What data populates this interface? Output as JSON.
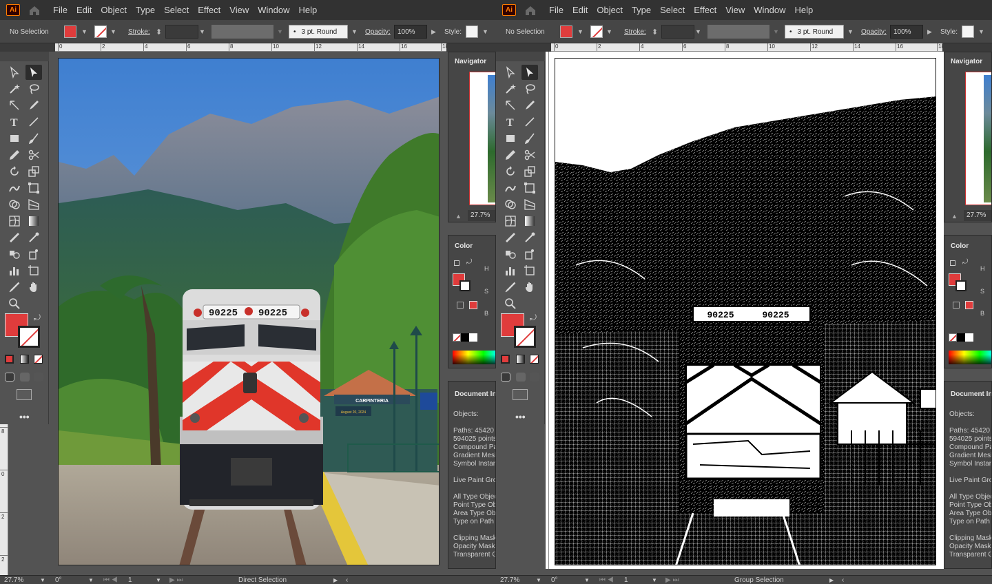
{
  "app": {
    "logo_text": "Ai"
  },
  "menu": [
    "File",
    "Edit",
    "Object",
    "Type",
    "Select",
    "Effect",
    "View",
    "Window",
    "Help"
  ],
  "control_bar": {
    "selection": "No Selection",
    "stroke_label": "Stroke:",
    "brush": "3 pt. Round",
    "opacity_label": "Opacity:",
    "opacity_value": "100%",
    "style_label": "Style:"
  },
  "ruler": {
    "h_ticks": [
      "0",
      "2",
      "4",
      "6",
      "8",
      "10",
      "12",
      "14",
      "16",
      "18"
    ],
    "v_ticks": [
      "8",
      "0",
      "2",
      "2",
      "2"
    ]
  },
  "panels": {
    "navigator": {
      "title": "Navigator",
      "zoom": "27.7%"
    },
    "color": {
      "title": "Color",
      "h": "H",
      "s": "S",
      "b": "B"
    },
    "document_info": {
      "title": "Document Info",
      "objects_label": "Objects:",
      "lines_a": [
        "Paths: 45420",
        "594025 points",
        "Compound Pa",
        "Gradient Mesh",
        "Symbol Instan"
      ],
      "lines_b": [
        "Live Paint Gro"
      ],
      "lines_c": [
        "All Type Objec",
        "Point Type Ob",
        "Area Type Obj",
        "Type on Path"
      ],
      "lines_d": [
        "Clipping Mask",
        "Opacity Masks",
        "Transparent G"
      ]
    }
  },
  "left_window": {
    "status": {
      "zoom": "27.7%",
      "rotation": "0°",
      "artboard": "1",
      "tool": "Direct Selection"
    },
    "photo": {
      "locomotive_number": "90225",
      "station_sign": "CARPINTERIA",
      "date_sign": "August 20, 2024"
    }
  },
  "right_window": {
    "status": {
      "zoom": "27.7%",
      "rotation": "0°",
      "artboard": "1",
      "tool": "Group Selection"
    },
    "trace": {
      "locomotive_number": "90225"
    }
  },
  "colors": {
    "fill": "#e03c3c",
    "ui_dark": "#323232",
    "ui_mid": "#535353",
    "ui_panel": "#464646"
  },
  "icons": [
    "home-icon",
    "direct-selection-icon",
    "group-selection-icon",
    "magic-wand-icon",
    "lasso-icon",
    "pen-icon",
    "type-icon",
    "line-icon",
    "rectangle-icon",
    "paintbrush-icon",
    "pencil-icon",
    "scissors-icon",
    "rotate-icon",
    "scale-icon",
    "warp-icon",
    "free-transform-icon",
    "shape-builder-icon",
    "perspective-icon",
    "mesh-icon",
    "gradient-icon",
    "eyedropper-icon",
    "blend-icon",
    "symbol-sprayer-icon",
    "graph-icon",
    "artboard-icon",
    "slice-icon",
    "hand-icon",
    "zoom-icon",
    "more-tools-icon"
  ]
}
